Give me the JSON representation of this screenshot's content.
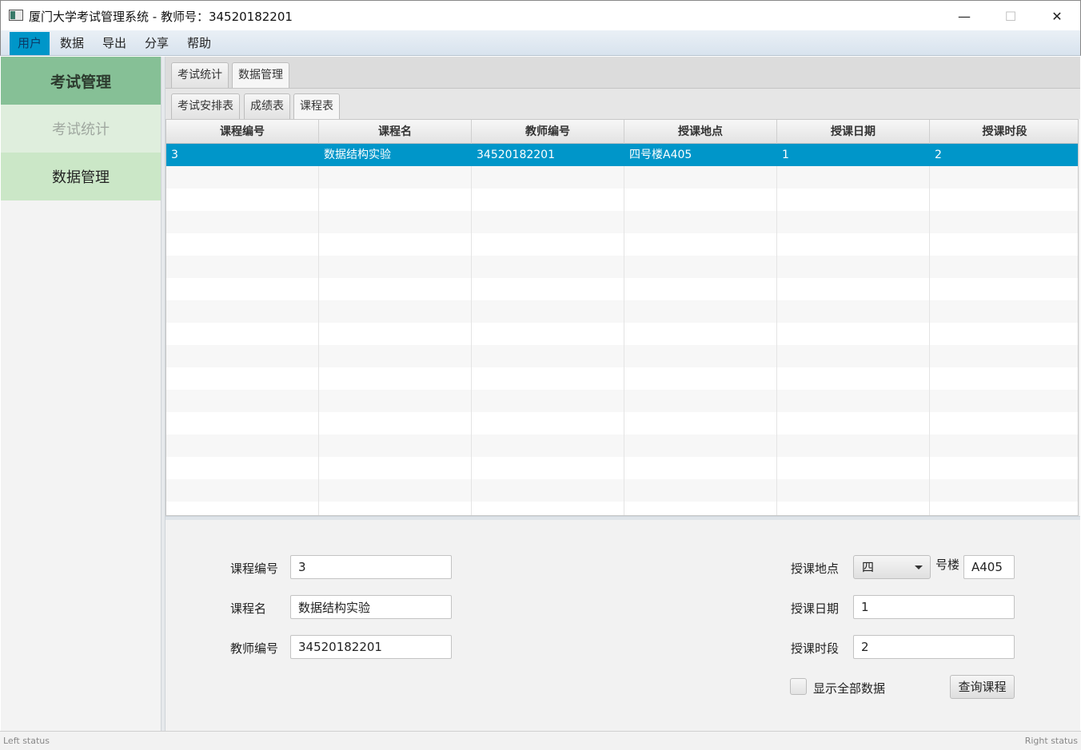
{
  "window": {
    "title": "厦门大学考试管理系统 - 教师号：34520182201",
    "min_glyph": "—",
    "max_glyph": "☐",
    "close_glyph": "✕"
  },
  "menu": [
    "用户",
    "数据",
    "导出",
    "分享",
    "帮助"
  ],
  "sidebar": {
    "header": "考试管理",
    "items": [
      "考试统计",
      "数据管理"
    ]
  },
  "tabs_top": [
    "考试统计",
    "数据管理"
  ],
  "tabs_sub": [
    "考试安排表",
    "成绩表",
    "课程表"
  ],
  "table": {
    "columns": [
      "课程编号",
      "课程名",
      "教师编号",
      "授课地点",
      "授课日期",
      "授课时段"
    ],
    "rows": [
      [
        "3",
        "数据结构实验",
        "34520182201",
        "四号楼A405",
        "1",
        "2"
      ]
    ]
  },
  "form": {
    "course_id_label": "课程编号",
    "course_id_value": "3",
    "course_name_label": "课程名",
    "course_name_value": "数据结构实验",
    "teacher_id_label": "教师编号",
    "teacher_id_value": "34520182201",
    "location_label": "授课地点",
    "building_value": "四",
    "building_suffix": "号楼",
    "room_value": "A405",
    "date_label": "授课日期",
    "date_value": "1",
    "period_label": "授课时段",
    "period_value": "2",
    "show_all_label": "显示全部数据",
    "query_button": "查询课程"
  },
  "status": {
    "left": "Left status",
    "right": "Right status"
  },
  "colors": {
    "accent": "#0096c9",
    "sidebar_header": "#86c096",
    "sidebar_item": "#cbe7c7"
  }
}
